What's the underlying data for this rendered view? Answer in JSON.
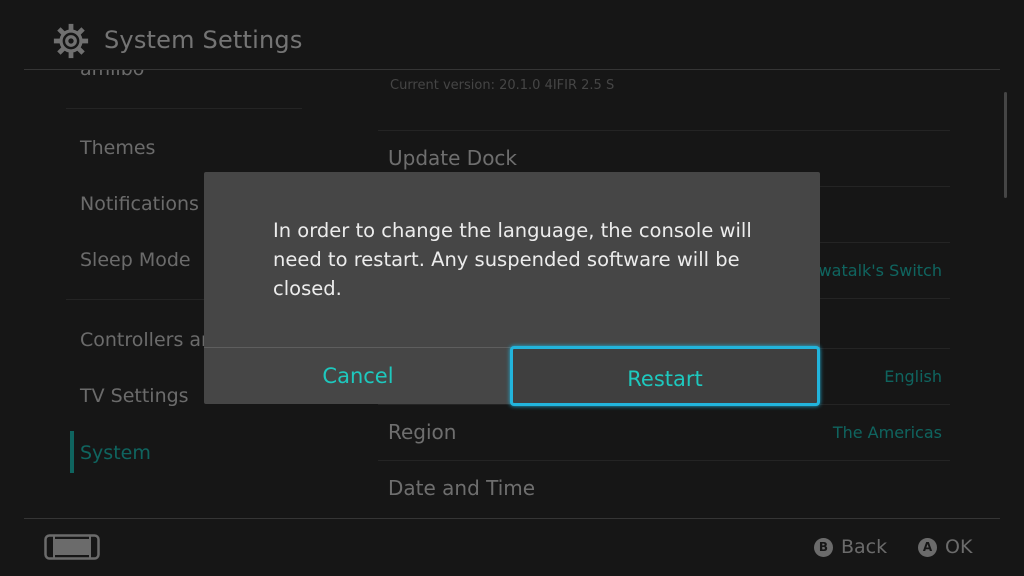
{
  "header": {
    "title": "System Settings",
    "icon": "gear-icon"
  },
  "sidebar": {
    "items": [
      {
        "label": "amiibo"
      },
      {
        "label": "Themes"
      },
      {
        "label": "Notifications"
      },
      {
        "label": "Sleep Mode"
      },
      {
        "label": "Controllers and Sensors"
      },
      {
        "label": "TV Settings"
      },
      {
        "label": "System"
      }
    ],
    "active": "System"
  },
  "main": {
    "current_version": "Current version: 20.1.0 4IFIR 2.5 S",
    "rows": [
      {
        "label": "Update Dock",
        "value": ""
      },
      {
        "label": "",
        "value": ""
      },
      {
        "label": "",
        "value": "ewatalk's Switch"
      },
      {
        "label": "",
        "value": ""
      },
      {
        "label": "",
        "value": "English"
      },
      {
        "label": "Region",
        "value": "The Americas"
      },
      {
        "label": "Date and Time",
        "value": ""
      }
    ]
  },
  "dialog": {
    "message": "In order to change the language, the console will need to restart. Any suspended software will be closed.",
    "cancel_label": "Cancel",
    "restart_label": "Restart"
  },
  "footer": {
    "back_key": "B",
    "back_label": "Back",
    "ok_key": "A",
    "ok_label": "OK",
    "console_icon": "console-icon"
  },
  "colors": {
    "accent": "#1ec8be",
    "focus": "#22b4dc",
    "background": "#2d2d2d",
    "dialog": "#464646"
  }
}
